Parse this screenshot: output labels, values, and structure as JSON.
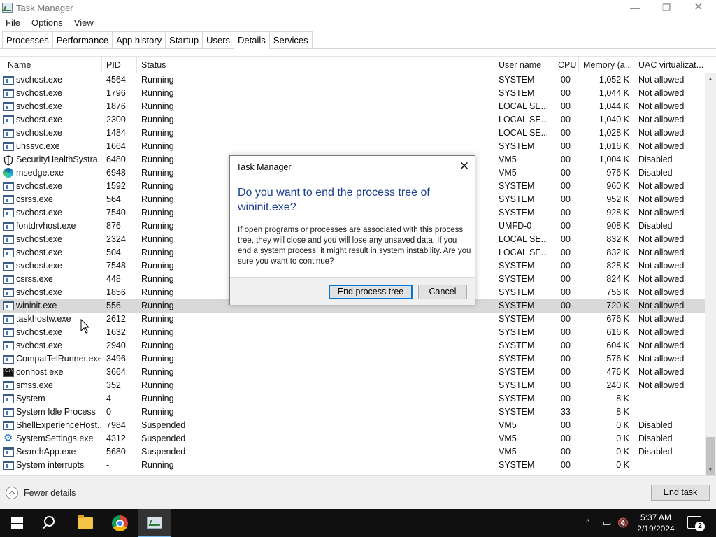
{
  "window": {
    "title": "Task Manager",
    "min_glyph": "—",
    "max_glyph": "❐",
    "close_glyph": "✕"
  },
  "menu": [
    "File",
    "Options",
    "View"
  ],
  "tabs": [
    "Processes",
    "Performance",
    "App history",
    "Startup",
    "Users",
    "Details",
    "Services"
  ],
  "active_tab": "Details",
  "columns": {
    "name": "Name",
    "pid": "PID",
    "status": "Status",
    "user": "User name",
    "cpu": "CPU",
    "memory": "Memory (a...",
    "uac": "UAC virtualizat..."
  },
  "rows": [
    {
      "icon": "window",
      "name": "svchost.exe",
      "pid": "4564",
      "status": "Running",
      "user": "SYSTEM",
      "cpu": "00",
      "mem": "1,052 K",
      "uac": "Not allowed"
    },
    {
      "icon": "window",
      "name": "svchost.exe",
      "pid": "1796",
      "status": "Running",
      "user": "SYSTEM",
      "cpu": "00",
      "mem": "1,044 K",
      "uac": "Not allowed"
    },
    {
      "icon": "window",
      "name": "svchost.exe",
      "pid": "1876",
      "status": "Running",
      "user": "LOCAL SE...",
      "cpu": "00",
      "mem": "1,044 K",
      "uac": "Not allowed"
    },
    {
      "icon": "window",
      "name": "svchost.exe",
      "pid": "2300",
      "status": "Running",
      "user": "LOCAL SE...",
      "cpu": "00",
      "mem": "1,040 K",
      "uac": "Not allowed"
    },
    {
      "icon": "window",
      "name": "svchost.exe",
      "pid": "1484",
      "status": "Running",
      "user": "LOCAL SE...",
      "cpu": "00",
      "mem": "1,028 K",
      "uac": "Not allowed"
    },
    {
      "icon": "window",
      "name": "uhssvc.exe",
      "pid": "1664",
      "status": "Running",
      "user": "SYSTEM",
      "cpu": "00",
      "mem": "1,016 K",
      "uac": "Not allowed"
    },
    {
      "icon": "shield",
      "name": "SecurityHealthSystra...",
      "pid": "6480",
      "status": "Running",
      "user": "VM5",
      "cpu": "00",
      "mem": "1,004 K",
      "uac": "Disabled"
    },
    {
      "icon": "edge",
      "name": "msedge.exe",
      "pid": "6948",
      "status": "Running",
      "user": "VM5",
      "cpu": "00",
      "mem": "976 K",
      "uac": "Disabled"
    },
    {
      "icon": "window",
      "name": "svchost.exe",
      "pid": "1592",
      "status": "Running",
      "user": "SYSTEM",
      "cpu": "00",
      "mem": "960 K",
      "uac": "Not allowed"
    },
    {
      "icon": "window",
      "name": "csrss.exe",
      "pid": "564",
      "status": "Running",
      "user": "SYSTEM",
      "cpu": "00",
      "mem": "952 K",
      "uac": "Not allowed"
    },
    {
      "icon": "window",
      "name": "svchost.exe",
      "pid": "7540",
      "status": "Running",
      "user": "SYSTEM",
      "cpu": "00",
      "mem": "928 K",
      "uac": "Not allowed"
    },
    {
      "icon": "window",
      "name": "fontdrvhost.exe",
      "pid": "876",
      "status": "Running",
      "user": "UMFD-0",
      "cpu": "00",
      "mem": "908 K",
      "uac": "Disabled"
    },
    {
      "icon": "window",
      "name": "svchost.exe",
      "pid": "2324",
      "status": "Running",
      "user": "LOCAL SE...",
      "cpu": "00",
      "mem": "832 K",
      "uac": "Not allowed"
    },
    {
      "icon": "window",
      "name": "svchost.exe",
      "pid": "504",
      "status": "Running",
      "user": "LOCAL SE...",
      "cpu": "00",
      "mem": "832 K",
      "uac": "Not allowed"
    },
    {
      "icon": "window",
      "name": "svchost.exe",
      "pid": "7548",
      "status": "Running",
      "user": "SYSTEM",
      "cpu": "00",
      "mem": "828 K",
      "uac": "Not allowed"
    },
    {
      "icon": "window",
      "name": "csrss.exe",
      "pid": "448",
      "status": "Running",
      "user": "SYSTEM",
      "cpu": "00",
      "mem": "824 K",
      "uac": "Not allowed"
    },
    {
      "icon": "window",
      "name": "svchost.exe",
      "pid": "1856",
      "status": "Running",
      "user": "SYSTEM",
      "cpu": "00",
      "mem": "756 K",
      "uac": "Not allowed"
    },
    {
      "icon": "window",
      "name": "wininit.exe",
      "pid": "556",
      "status": "Running",
      "user": "SYSTEM",
      "cpu": "00",
      "mem": "720 K",
      "uac": "Not allowed",
      "selected": true
    },
    {
      "icon": "window",
      "name": "taskhostw.exe",
      "pid": "2612",
      "status": "Running",
      "user": "SYSTEM",
      "cpu": "00",
      "mem": "676 K",
      "uac": "Not allowed"
    },
    {
      "icon": "window",
      "name": "svchost.exe",
      "pid": "1632",
      "status": "Running",
      "user": "SYSTEM",
      "cpu": "00",
      "mem": "616 K",
      "uac": "Not allowed"
    },
    {
      "icon": "window",
      "name": "svchost.exe",
      "pid": "2940",
      "status": "Running",
      "user": "SYSTEM",
      "cpu": "00",
      "mem": "604 K",
      "uac": "Not allowed"
    },
    {
      "icon": "window",
      "name": "CompatTelRunner.exe",
      "pid": "3496",
      "status": "Running",
      "user": "SYSTEM",
      "cpu": "00",
      "mem": "576 K",
      "uac": "Not allowed"
    },
    {
      "icon": "console",
      "name": "conhost.exe",
      "pid": "3664",
      "status": "Running",
      "user": "SYSTEM",
      "cpu": "00",
      "mem": "476 K",
      "uac": "Not allowed"
    },
    {
      "icon": "window",
      "name": "smss.exe",
      "pid": "352",
      "status": "Running",
      "user": "SYSTEM",
      "cpu": "00",
      "mem": "240 K",
      "uac": "Not allowed"
    },
    {
      "icon": "window",
      "name": "System",
      "pid": "4",
      "status": "Running",
      "user": "SYSTEM",
      "cpu": "00",
      "mem": "8 K",
      "uac": ""
    },
    {
      "icon": "window",
      "name": "System Idle Process",
      "pid": "0",
      "status": "Running",
      "user": "SYSTEM",
      "cpu": "33",
      "mem": "8 K",
      "uac": ""
    },
    {
      "icon": "window",
      "name": "ShellExperienceHost....",
      "pid": "7984",
      "status": "Suspended",
      "user": "VM5",
      "cpu": "00",
      "mem": "0 K",
      "uac": "Disabled"
    },
    {
      "icon": "gear",
      "name": "SystemSettings.exe",
      "pid": "4312",
      "status": "Suspended",
      "user": "VM5",
      "cpu": "00",
      "mem": "0 K",
      "uac": "Disabled"
    },
    {
      "icon": "window",
      "name": "SearchApp.exe",
      "pid": "5680",
      "status": "Suspended",
      "user": "VM5",
      "cpu": "00",
      "mem": "0 K",
      "uac": "Disabled"
    },
    {
      "icon": "window",
      "name": "System interrupts",
      "pid": "-",
      "status": "Running",
      "user": "SYSTEM",
      "cpu": "00",
      "mem": "0 K",
      "uac": ""
    }
  ],
  "footer": {
    "fewer_details": "Fewer details",
    "end_task": "End task"
  },
  "dialog": {
    "title": "Task Manager",
    "close_glyph": "✕",
    "heading": "Do you want to end the process tree of wininit.exe?",
    "body": "If open programs or processes are associated with this process tree, they will close and you will lose any unsaved data. If you end a system process, it might result in system instability. Are you sure you want to continue?",
    "primary_button": "End process tree",
    "cancel_button": "Cancel"
  },
  "taskbar": {
    "time": "5:37 AM",
    "date": "2/19/2024",
    "notification_count": "2",
    "tray_chevron": "^",
    "network_glyph": "▭",
    "volume_glyph": "🔇"
  },
  "icons": {
    "scroll_up": "▲",
    "scroll_down": "▼",
    "sort_arrow": "⌄",
    "gear": "⚙"
  }
}
